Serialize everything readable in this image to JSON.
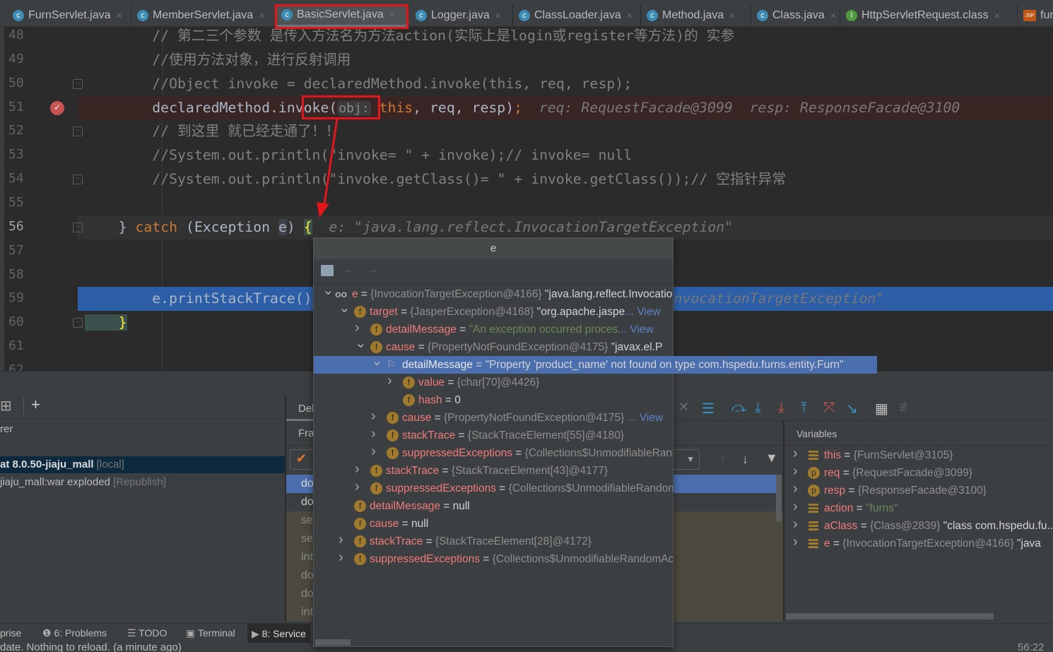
{
  "tabs": [
    {
      "label": "FurnServlet.java",
      "icon": "class-icon",
      "type": "c"
    },
    {
      "label": "MemberServlet.java",
      "icon": "class-icon",
      "type": "c"
    },
    {
      "label": "BasicServlet.java",
      "icon": "class-icon",
      "type": "c",
      "active": true
    },
    {
      "label": "Logger.java",
      "icon": "class-locked-icon",
      "type": "c"
    },
    {
      "label": "ClassLoader.java",
      "icon": "class-locked-icon",
      "type": "c"
    },
    {
      "label": "Method.java",
      "icon": "class-locked-icon",
      "type": "c"
    },
    {
      "label": "Class.java",
      "icon": "class-locked-icon",
      "type": "c"
    },
    {
      "label": "HttpServletRequest.class",
      "icon": "interface-icon",
      "type": "i"
    },
    {
      "label": "fur",
      "icon": "jsp-icon",
      "type": "jsp"
    }
  ],
  "tab_close_glyph": "×",
  "editor": {
    "lines": [
      {
        "n": "48",
        "segs": [
          {
            "t": "        // 第二三个参数 是传入方法名为方法action(实际上是login或register等方法)的 实参",
            "c": "c-comment"
          }
        ]
      },
      {
        "n": "49",
        "segs": [
          {
            "t": "        //使用方法对象，进行反射调用",
            "c": "c-comment"
          }
        ]
      },
      {
        "n": "50",
        "segs": [
          {
            "t": "        //Object invoke = declaredMethod.invoke(this, req, resp);",
            "c": "c-comment"
          }
        ]
      },
      {
        "n": "51",
        "bg": "#3a2525",
        "breakpoint": true,
        "segs": [
          {
            "t": "        declaredMethod.invoke(",
            "c": ""
          },
          {
            "t": "obj:",
            "c": "c-param"
          },
          {
            "t": " this",
            "c": "c-kw"
          },
          {
            "t": ", req, resp)",
            "c": ""
          },
          {
            "t": ";",
            "c": "c-kw"
          },
          {
            "t": "  req: RequestFacade@3099  resp: ResponseFacade@3100",
            "c": "c-hint"
          }
        ]
      },
      {
        "n": "52",
        "segs": [
          {
            "t": "        // 到这里 就已经走通了！！",
            "c": "c-comment"
          }
        ]
      },
      {
        "n": "53",
        "segs": [
          {
            "t": "        //System.out.println(\"invoke= \" + invoke);// invoke= null",
            "c": "c-comment"
          }
        ]
      },
      {
        "n": "54",
        "segs": [
          {
            "t": "        //System.out.println(\"invoke.getClass()= \" + invoke.getClass());// 空指针异常",
            "c": "c-comment"
          }
        ]
      },
      {
        "n": "55",
        "segs": []
      },
      {
        "n": "56",
        "bg": "#323232",
        "current": true,
        "segs": [
          {
            "t": "    } ",
            "c": ""
          },
          {
            "t": "catch",
            "c": "c-kw"
          },
          {
            "t": " (Exception ",
            "c": ""
          },
          {
            "t": "e",
            "c": "c-evar"
          },
          {
            "t": ") ",
            "c": ""
          },
          {
            "t": "{",
            "c": "c-brace"
          },
          {
            "t": "  e: \"java.lang.reflect.InvocationTargetException\"",
            "c": "c-hint"
          }
        ]
      },
      {
        "n": "57",
        "segs": []
      },
      {
        "n": "58",
        "segs": []
      },
      {
        "n": "59",
        "bg": "#2d5fa8",
        "segs": [
          {
            "t": "        e.printStackTrace();",
            "c": ""
          },
          {
            "t": "                   e: \"java.lang.reflect.InvocationTargetException\"",
            "c": "c-hint"
          }
        ]
      },
      {
        "n": "60",
        "segs": [
          {
            "t": "    }",
            "c": "c-brace"
          }
        ]
      },
      {
        "n": "61",
        "segs": []
      },
      {
        "n": "62",
        "segs": []
      }
    ]
  },
  "popup": {
    "title": "e",
    "tree": [
      {
        "lvl": 0,
        "exp": "down",
        "icon": "watch",
        "name": "e",
        "val": [
          {
            "t": "{InvocationTargetException@4166}",
            "c": "vgray"
          },
          {
            "t": " \"java.lang.reflect.InvocationTargetException\"",
            "c": "vwhite"
          }
        ]
      },
      {
        "lvl": 1,
        "exp": "down",
        "icon": "f",
        "name": "target",
        "val": [
          {
            "t": "{JasperException@4168}",
            "c": "vgray"
          },
          {
            "t": " \"org.apache.jaspe",
            "c": "vwhite"
          },
          {
            "t": "... View",
            "c": "vlink"
          }
        ]
      },
      {
        "lvl": 2,
        "exp": "right",
        "icon": "f",
        "name": "detailMessage",
        "val": [
          {
            "t": "\"An exception occurred proces",
            "c": "vgreen"
          },
          {
            "t": "... View",
            "c": "vlink"
          }
        ]
      },
      {
        "lvl": 2,
        "exp": "down",
        "icon": "f",
        "name": "cause",
        "val": [
          {
            "t": "{PropertyNotFoundException@4175}",
            "c": "vgray"
          },
          {
            "t": " \"javax.el.P",
            "c": "vwhite"
          }
        ]
      },
      {
        "lvl": 3,
        "exp": "down",
        "icon": "flag",
        "name": "detailMessage",
        "sel": true,
        "val": [
          {
            "t": "\"Property 'product_name' not found on type com.hspedu.furns.entity.Furn\"",
            "c": "vwhite"
          }
        ]
      },
      {
        "lvl": 4,
        "exp": "right",
        "icon": "f",
        "name": "value",
        "val": [
          {
            "t": "{char[70]@4426}",
            "c": "vgray"
          }
        ]
      },
      {
        "lvl": 4,
        "exp": "",
        "icon": "f",
        "name": "hash",
        "val": [
          {
            "t": "0",
            "c": "vwhite"
          }
        ]
      },
      {
        "lvl": 3,
        "exp": "right",
        "icon": "f",
        "name": "cause",
        "val": [
          {
            "t": "{PropertyNotFoundException@4175}",
            "c": "vgray"
          },
          {
            "t": " ... View",
            "c": "vlink"
          }
        ]
      },
      {
        "lvl": 3,
        "exp": "right",
        "icon": "f",
        "name": "stackTrace",
        "val": [
          {
            "t": "{StackTraceElement[55]@4180}",
            "c": "vgray"
          }
        ]
      },
      {
        "lvl": 3,
        "exp": "right",
        "icon": "f",
        "name": "suppressedExceptions",
        "val": [
          {
            "t": "{Collections$UnmodifiableRandomAccessList}",
            "c": "vgray"
          }
        ]
      },
      {
        "lvl": 2,
        "exp": "right",
        "icon": "f",
        "name": "stackTrace",
        "val": [
          {
            "t": "{StackTraceElement[43]@4177}",
            "c": "vgray"
          }
        ]
      },
      {
        "lvl": 2,
        "exp": "right",
        "icon": "f",
        "name": "suppressedExceptions",
        "val": [
          {
            "t": "{Collections$UnmodifiableRandomAccessList}",
            "c": "vgray"
          }
        ]
      },
      {
        "lvl": 1,
        "exp": "",
        "icon": "f",
        "name": "detailMessage",
        "val": [
          {
            "t": "null",
            "c": "vwhite"
          }
        ]
      },
      {
        "lvl": 1,
        "exp": "",
        "icon": "f",
        "name": "cause",
        "val": [
          {
            "t": "null",
            "c": "vwhite"
          }
        ]
      },
      {
        "lvl": 1,
        "exp": "right",
        "icon": "f",
        "name": "stackTrace",
        "val": [
          {
            "t": "{StackTraceElement[28]@4172}",
            "c": "vgray"
          }
        ]
      },
      {
        "lvl": 1,
        "exp": "right",
        "icon": "f",
        "name": "suppressedExceptions",
        "val": [
          {
            "t": "{Collections$UnmodifiableRandomAccessList}",
            "c": "vgray"
          }
        ]
      }
    ]
  },
  "services": {
    "header": "rer",
    "items": [
      {
        "label": "at 8.0.50-jiaju_mall",
        "tag": "[local]",
        "selected": true
      },
      {
        "label": "jiaju_mall:war exploded",
        "tag": "[Republish]"
      }
    ]
  },
  "debug": {
    "tab_label": "Deb",
    "frames_label": "Fra",
    "frames": [
      "do",
      "do",
      "se",
      "se",
      "int",
      "do",
      "do",
      "int"
    ],
    "variables_label": "Variables",
    "variables": [
      {
        "icon": "field-bars",
        "name": "this",
        "val": [
          {
            "t": "{FurnServlet@3105}",
            "c": "vgray"
          }
        ]
      },
      {
        "icon": "p",
        "name": "req",
        "val": [
          {
            "t": "{RequestFacade@3099}",
            "c": "vgray"
          }
        ]
      },
      {
        "icon": "p",
        "name": "resp",
        "val": [
          {
            "t": "{ResponseFacade@3100}",
            "c": "vgray"
          }
        ]
      },
      {
        "icon": "field-bars",
        "name": "action",
        "val": [
          {
            "t": "\"furns\"",
            "c": "vgreen"
          }
        ]
      },
      {
        "icon": "field-bars",
        "name": "aClass",
        "val": [
          {
            "t": "{Class@2839}",
            "c": "vgray"
          },
          {
            "t": " \"class com.hspedu.fu...",
            "c": "vwhite"
          }
        ]
      },
      {
        "icon": "field-bars",
        "name": "e",
        "val": [
          {
            "t": "{InvocationTargetException@4166}",
            "c": "vgray"
          },
          {
            "t": " \"java",
            "c": "vwhite"
          }
        ]
      }
    ]
  },
  "toolstrip": {
    "items": [
      {
        "label": "prise"
      },
      {
        "icon": "problems-icon",
        "label": "6: Problems"
      },
      {
        "icon": "todo-icon",
        "label": "TODO"
      },
      {
        "icon": "terminal-icon",
        "label": "Terminal"
      },
      {
        "icon": "services-icon",
        "label": "8: Service",
        "active": true
      }
    ]
  },
  "status": {
    "message": "date. Nothing to reload. (a minute ago)",
    "position": "56:22"
  },
  "colors": {
    "annotation": "#e0161b",
    "selection": "#4b6eaf",
    "exec_line": "#2d5fa8",
    "breakpoint_line": "#3a2525"
  }
}
